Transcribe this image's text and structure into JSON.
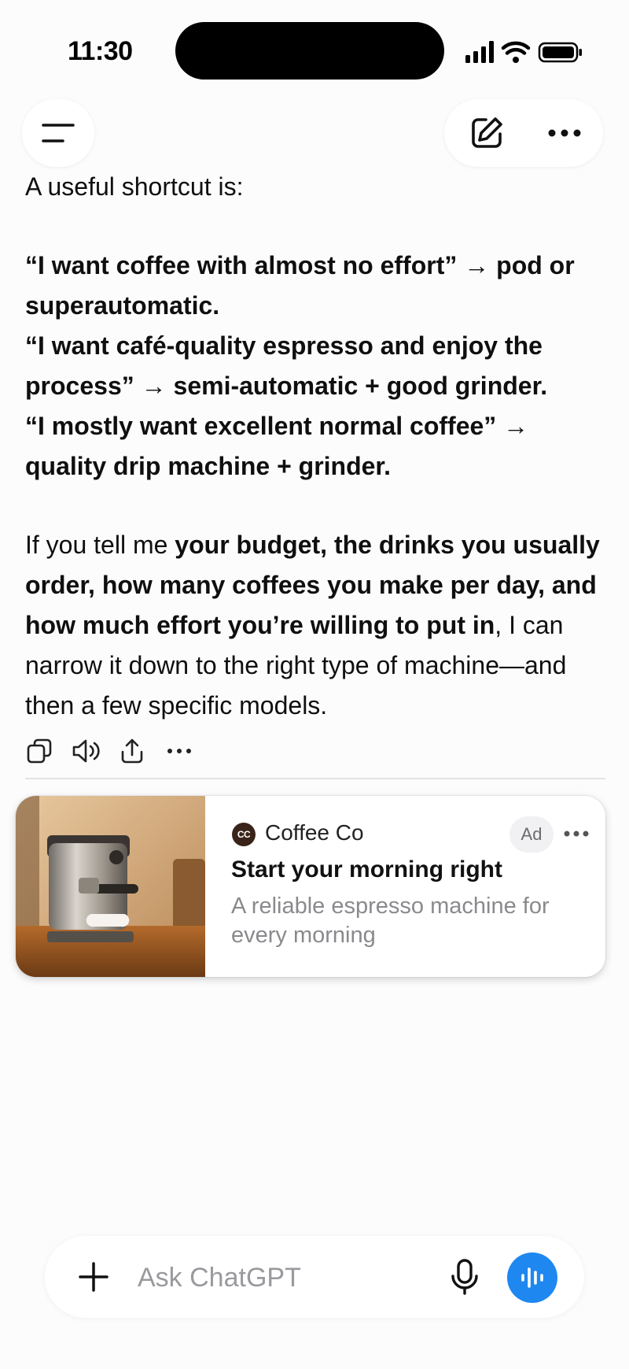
{
  "status_bar": {
    "time": "11:30",
    "icons": [
      "signal-icon",
      "wifi-icon",
      "battery-icon"
    ]
  },
  "header": {
    "icons": [
      "menu-icon",
      "new-chat-icon",
      "more-options-icon"
    ]
  },
  "message": {
    "intro": "A useful shortcut is:",
    "shortcuts": [
      "“I want coffee with almost no effort” → pod or superautomatic.",
      "“I want café-quality espresso and enjoy the process” → semi-automatic + good grinder.",
      "“I mostly want excellent normal coffee” → quality drip machine + grinder."
    ],
    "closing_start": "If you tell me ",
    "closing_bold": "your budget, the drinks you usually order, how many coffees you make per day, and how much effort you’re willing to put in",
    "closing_end": ", I can narrow it down to the right type of machine—and then a few specific models."
  },
  "message_actions": {
    "icons": [
      "copy-icon",
      "read-aloud-icon",
      "share-icon",
      "more-icon"
    ]
  },
  "ad": {
    "logo_text": "CC",
    "brand": "Coffee Co",
    "badge": "Ad",
    "title": "Start your morning right",
    "description": "A reliable espresso machine for every morning"
  },
  "composer": {
    "placeholder": "Ask ChatGPT",
    "value": "",
    "icons": [
      "plus-icon",
      "microphone-icon",
      "voice-mode-icon"
    ]
  },
  "colors": {
    "background": "#fcfcfd",
    "accent": "#1e88f0",
    "text": "#0f0f0f",
    "muted": "#8a8a8e"
  }
}
